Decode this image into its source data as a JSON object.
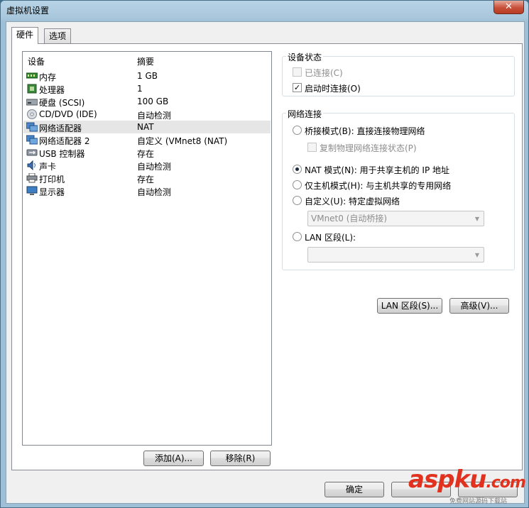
{
  "window": {
    "title": "虚拟机设置",
    "close_glyph": "✕"
  },
  "tabs": [
    {
      "label": "硬件"
    },
    {
      "label": "选项"
    }
  ],
  "device_list": {
    "col_device": "设备",
    "col_summary": "摘要",
    "rows": [
      {
        "name": "内存",
        "summary": "1 GB",
        "icon": "memory-icon"
      },
      {
        "name": "处理器",
        "summary": "1",
        "icon": "processor-icon"
      },
      {
        "name": "硬盘 (SCSI)",
        "summary": "100 GB",
        "icon": "hard-disk-icon"
      },
      {
        "name": "CD/DVD (IDE)",
        "summary": "自动检测",
        "icon": "cd-dvd-icon"
      },
      {
        "name": "网络适配器",
        "summary": "NAT",
        "icon": "network-adapter-icon",
        "selected": true
      },
      {
        "name": "网络适配器 2",
        "summary": "自定义 (VMnet8 (NAT)",
        "icon": "network-adapter-icon"
      },
      {
        "name": "USB 控制器",
        "summary": "存在",
        "icon": "usb-icon"
      },
      {
        "name": "声卡",
        "summary": "自动检测",
        "icon": "sound-card-icon"
      },
      {
        "name": "打印机",
        "summary": "存在",
        "icon": "printer-icon"
      },
      {
        "name": "显示器",
        "summary": "自动检测",
        "icon": "display-icon"
      }
    ]
  },
  "list_buttons": {
    "add": "添加(A)...",
    "remove": "移除(R)"
  },
  "device_status": {
    "title": "设备状态",
    "connected": {
      "label": "已连接(C)",
      "checked": false,
      "enabled": false
    },
    "connect_at_power_on": {
      "label": "启动时连接(O)",
      "checked": true,
      "enabled": true
    }
  },
  "network_connection": {
    "title": "网络连接",
    "bridged": {
      "label": "桥接模式(B): 直接连接物理网络",
      "selected": false
    },
    "replicate": {
      "label": "复制物理网络连接状态(P)",
      "checked": false
    },
    "nat": {
      "label": "NAT 模式(N): 用于共享主机的 IP 地址",
      "selected": true
    },
    "host_only": {
      "label": "仅主机模式(H): 与主机共享的专用网络",
      "selected": false
    },
    "custom": {
      "label": "自定义(U): 特定虚拟网络",
      "selected": false
    },
    "custom_select_value": "VMnet0 (自动桥接)",
    "lan_segment": {
      "label": "LAN 区段(L):",
      "selected": false
    },
    "lan_select_value": ""
  },
  "action_buttons": {
    "lan_segments": "LAN 区段(S)...",
    "advanced": "高级(V)..."
  },
  "footer_buttons": {
    "ok": "确定"
  },
  "watermark": {
    "text_asp": "asp",
    "text_ku": "ku",
    "text_com": ".com",
    "subtitle": "免费网站源码下载站"
  },
  "colors": {
    "title_bar": "#a9c7dc",
    "selected_row": "#e6e6e6",
    "watermark": "#e0321e"
  }
}
